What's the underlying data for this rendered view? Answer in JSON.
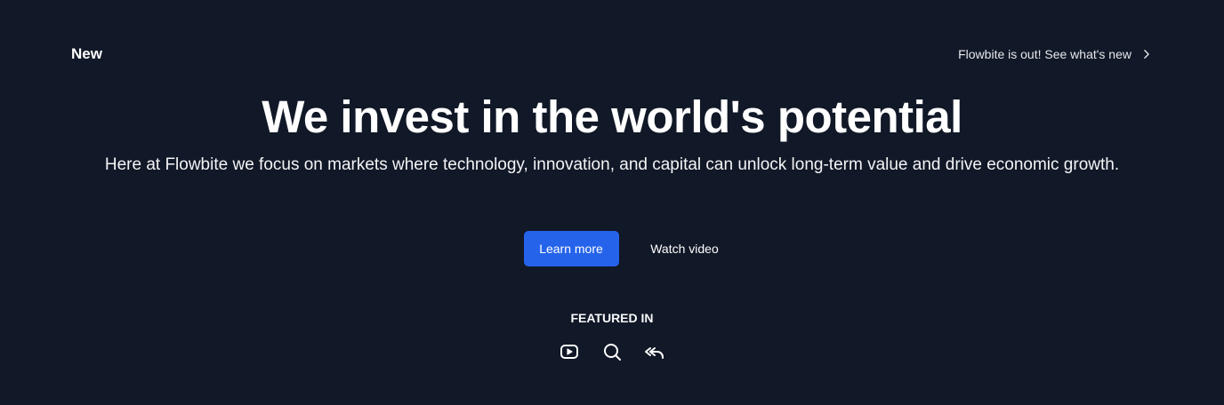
{
  "hero": {
    "tag": "New",
    "announcement": {
      "text": "Flowbite is out! See what's new",
      "icon": "chevron-right-icon"
    },
    "headline": "We invest in the world's potential",
    "subtitle": "Here at Flowbite we focus on markets where technology, innovation, and capital can unlock long-term value and drive economic growth.",
    "primary_button": "Learn more",
    "secondary_button": "Watch video"
  },
  "featured": {
    "label": "FEATURED IN",
    "icons": [
      "youtube-icon",
      "search-icon",
      "reply-all-icon"
    ]
  },
  "colors": {
    "background": "#111827",
    "primary": "#2563eb",
    "text": "#ffffff"
  }
}
